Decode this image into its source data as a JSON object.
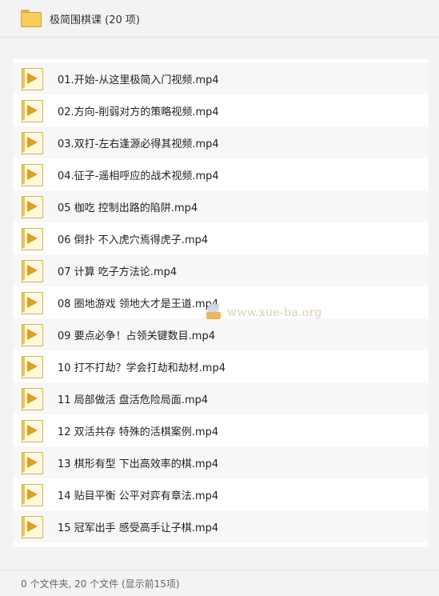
{
  "header": {
    "title": "极简围棋课 (20 项)",
    "icon": "folder-icon"
  },
  "files": [
    {
      "name": "01.开始-从这里极简入门视频.mp4"
    },
    {
      "name": "02.方向-削弱对方的策略视频.mp4"
    },
    {
      "name": "03.双打-左右逢源必得其视频.mp4"
    },
    {
      "name": "04.征子-遥相呼应的战术视频.mp4"
    },
    {
      "name": "05 枷吃 控制出路的陷阱.mp4"
    },
    {
      "name": "06 倒扑 不入虎穴焉得虎子.mp4"
    },
    {
      "name": "07 计算 吃子方法论.mp4"
    },
    {
      "name": "08 圈地游戏 领地大才是王道.mp4"
    },
    {
      "name": "09 要点必争！占领关键数目.mp4"
    },
    {
      "name": "10 打不打劫？学会打劫和劫材.mp4"
    },
    {
      "name": "11 局部做活 盘活危险局面.mp4"
    },
    {
      "name": "12 双活共存 特殊的活棋案例.mp4"
    },
    {
      "name": "13 棋形有型 下出高效率的棋.mp4"
    },
    {
      "name": "14 贴目平衡 公平对弈有章法.mp4"
    },
    {
      "name": "15 冠军出手 感受高手让子棋.mp4"
    }
  ],
  "file_icon": "video-file-icon",
  "watermark": {
    "text": "www.xue-ba.org"
  },
  "status": {
    "text": "0 个文件夹, 20 个文件 (显示前15项)"
  },
  "colors": {
    "background": "#f3f3f3",
    "panel": "#ffffff",
    "icon_accent": "#dca21d"
  }
}
